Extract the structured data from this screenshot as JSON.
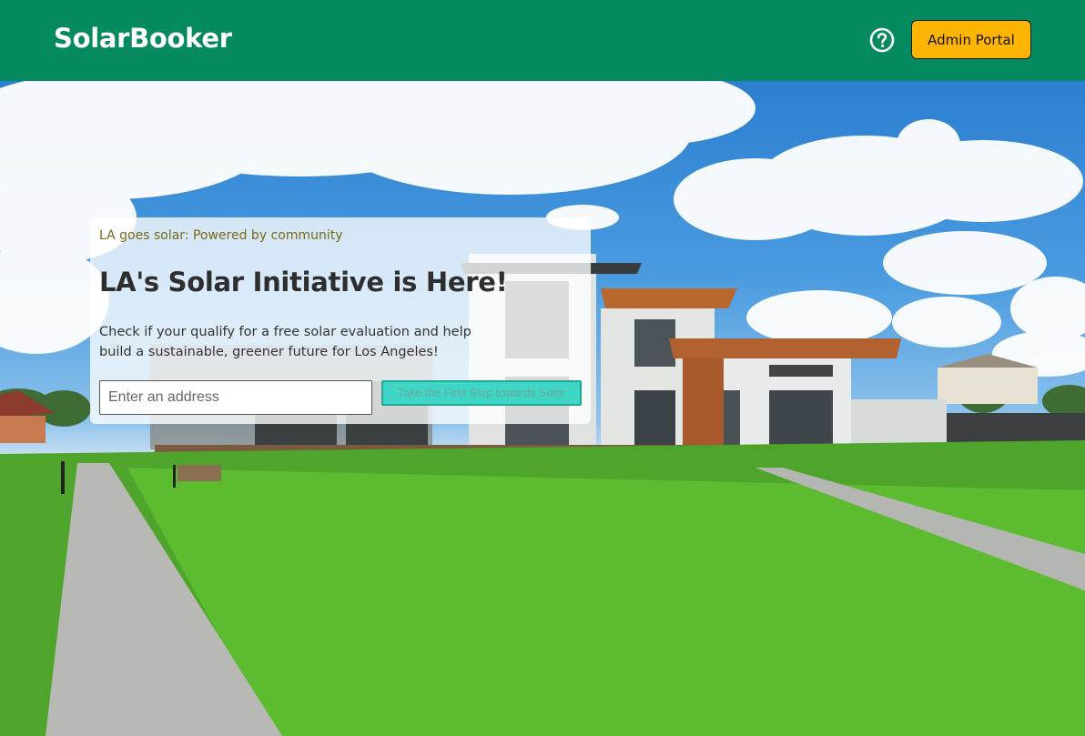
{
  "header": {
    "brand": "SolarBooker",
    "help_icon": "help-circle-icon",
    "admin_label": "Admin Portal"
  },
  "hero": {
    "tagline": "LA goes solar: Powered by community",
    "title": "LA's Solar Initiative is Here!",
    "description": "Check if your qualify for a free solar evaluation and help build a sustainable, greener future for Los Angeles!",
    "address_placeholder": "Enter an address",
    "cta_label": "Take the First Step towards Solar"
  },
  "colors": {
    "header_bg": "#048a5e",
    "admin_button": "#ffb400",
    "cta_button": "#3fd6c6"
  }
}
